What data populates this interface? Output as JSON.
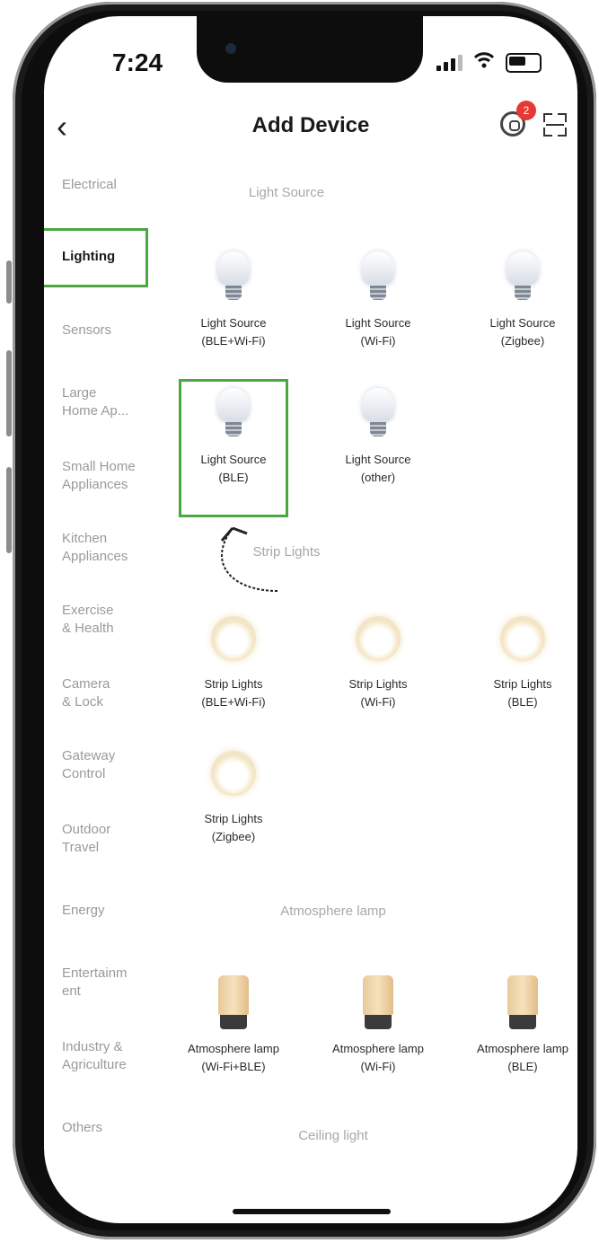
{
  "status_bar": {
    "time": "7:24"
  },
  "nav": {
    "back": "‹",
    "title": "Add Device",
    "notification_count": "2"
  },
  "categories": [
    {
      "label": "Electrical"
    },
    {
      "label": "Lighting"
    },
    {
      "label": "Sensors"
    },
    {
      "label": "Large\nHome Ap..."
    },
    {
      "label": "Small Home\nAppliances"
    },
    {
      "label": "Kitchen\nAppliances"
    },
    {
      "label": "Exercise\n& Health"
    },
    {
      "label": "Camera\n& Lock"
    },
    {
      "label": "Gateway\nControl"
    },
    {
      "label": "Outdoor\nTravel"
    },
    {
      "label": "Energy"
    },
    {
      "label": "Entertainm\nent"
    },
    {
      "label": "Industry &\nAgriculture"
    },
    {
      "label": "Others"
    }
  ],
  "sections": {
    "light_source": {
      "title": "Light Source",
      "devices": [
        {
          "label": "Light Source\n(BLE+Wi-Fi)"
        },
        {
          "label": "Light Source\n(Wi-Fi)"
        },
        {
          "label": "Light Source\n(Zigbee)"
        },
        {
          "label": "Light Source\n(BLE)"
        },
        {
          "label": "Light Source\n(other)"
        }
      ]
    },
    "strip_lights": {
      "title": "Strip Lights",
      "devices": [
        {
          "label": "Strip Lights\n(BLE+Wi-Fi)"
        },
        {
          "label": "Strip Lights\n(Wi-Fi)"
        },
        {
          "label": "Strip Lights\n(BLE)"
        },
        {
          "label": "Strip Lights\n(Zigbee)"
        }
      ]
    },
    "atmosphere_lamp": {
      "title": "Atmosphere lamp",
      "devices": [
        {
          "label": "Atmosphere lamp\n(Wi-Fi+BLE)"
        },
        {
          "label": "Atmosphere lamp\n(Wi-Fi)"
        },
        {
          "label": "Atmosphere lamp\n(BLE)"
        }
      ]
    },
    "ceiling_light": {
      "title": "Ceiling light"
    }
  },
  "colors": {
    "highlight": "#4aa742",
    "badge": "#e53935"
  }
}
